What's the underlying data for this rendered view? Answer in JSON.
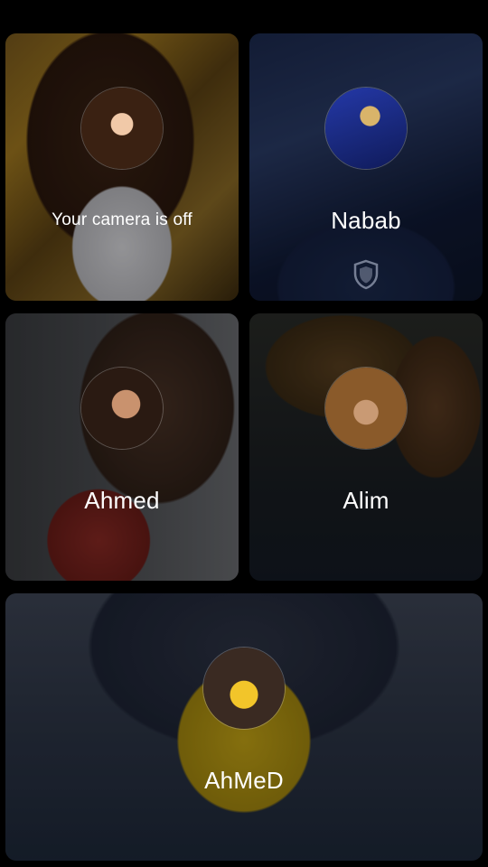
{
  "participants": [
    {
      "label": "Your camera is off",
      "is_self": true
    },
    {
      "label": "Nabab",
      "is_self": false
    },
    {
      "label": "Ahmed",
      "is_self": false
    },
    {
      "label": "Alim",
      "is_self": false
    },
    {
      "label": "AhMeD",
      "is_self": false
    }
  ]
}
